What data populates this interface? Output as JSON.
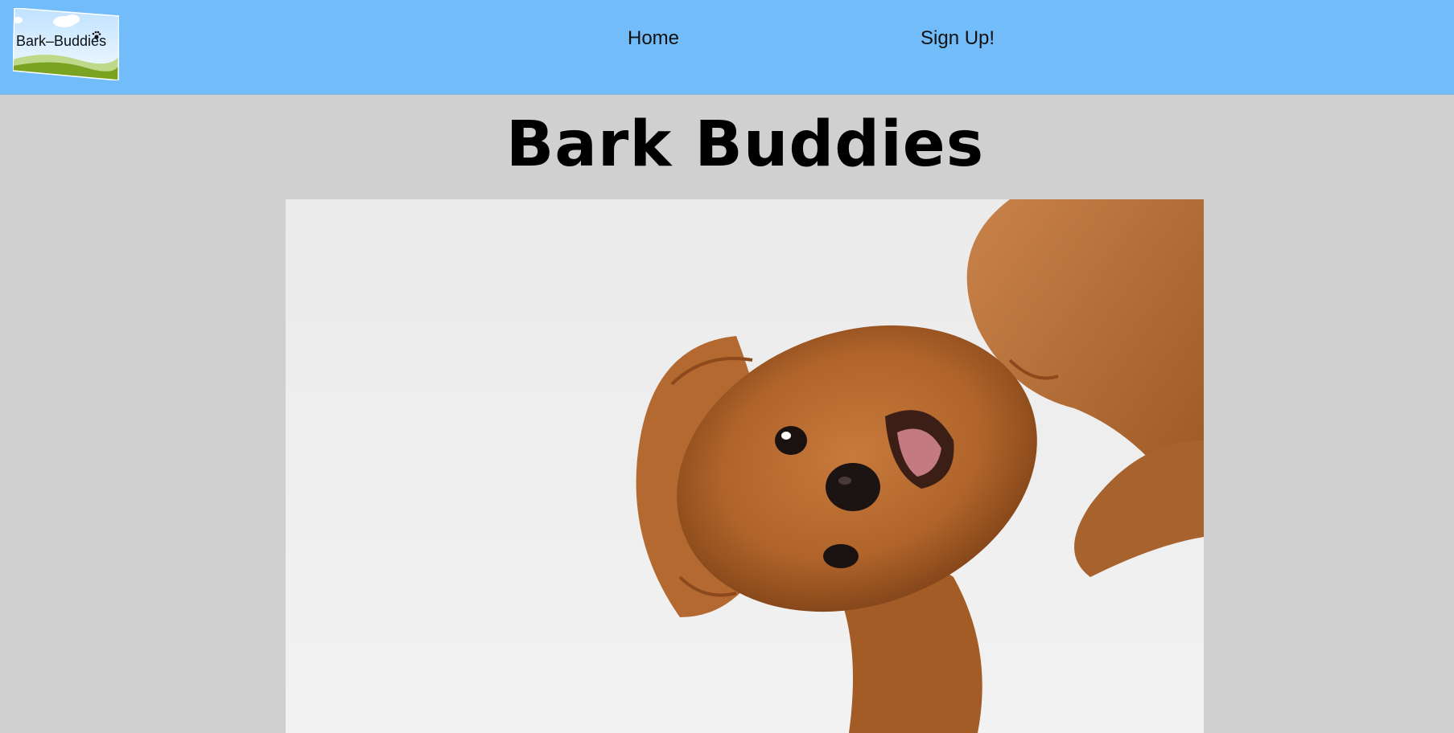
{
  "header": {
    "logo_text": "Bark–Buddies",
    "nav": [
      {
        "label": "Home"
      },
      {
        "label": "Sign Up!"
      }
    ],
    "background_color": "#72bcfa"
  },
  "main": {
    "title": "Bark Buddies",
    "hero_image": {
      "subject": "dog",
      "icon": "dog-photo"
    },
    "background_color": "#d0d0d0"
  }
}
